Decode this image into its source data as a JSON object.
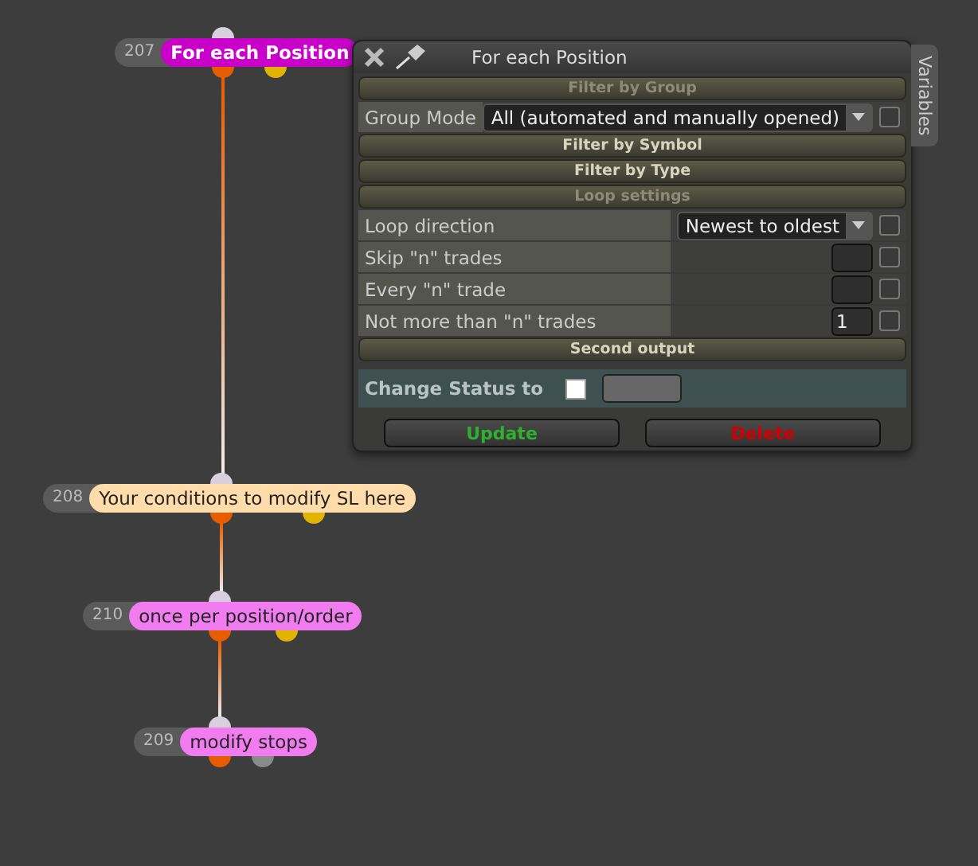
{
  "nodes": [
    {
      "number": "207",
      "label": "For each Position",
      "color": "#c800c8",
      "outputs": [
        {
          "color": "#e85c00"
        },
        {
          "color": "#e0b400"
        }
      ]
    },
    {
      "number": "208",
      "label": "Your conditions to modify SL here",
      "color": "#ffdcaa",
      "outputs": [
        {
          "color": "#e85c00"
        },
        {
          "color": "#e0b400"
        }
      ]
    },
    {
      "number": "210",
      "label": "once per position/order",
      "color": "#f07cf0",
      "outputs": [
        {
          "color": "#e85c00"
        },
        {
          "color": "#e0b400"
        }
      ]
    },
    {
      "number": "209",
      "label": "modify stops",
      "color": "#f07cf0",
      "outputs": [
        {
          "color": "#e85c00"
        },
        {
          "color": "#8a8a8a"
        }
      ]
    }
  ],
  "panel": {
    "title": "For each Position",
    "side_tab": "Variables",
    "sections": [
      {
        "title": "Filter by Group",
        "expanded": true,
        "rows": [
          {
            "kind": "select",
            "label": "Group Mode",
            "value": "All (automated and manually opened)",
            "checked": false
          }
        ]
      },
      {
        "title": "Filter by Symbol",
        "expanded": false
      },
      {
        "title": "Filter by Type",
        "expanded": false
      },
      {
        "title": "Loop settings",
        "expanded": true,
        "rows": [
          {
            "kind": "select",
            "label": "Loop direction",
            "value": "Newest to oldest",
            "checked": false
          },
          {
            "kind": "number",
            "label": "Skip \"n\" trades",
            "checked": false
          },
          {
            "kind": "number",
            "label": "Every \"n\" trade",
            "checked": false
          },
          {
            "kind": "number",
            "label": "Not more than \"n\" trades",
            "value": "1",
            "checked": false
          }
        ]
      },
      {
        "title": "Second output",
        "expanded": false
      }
    ],
    "status": {
      "label": "Change Status to",
      "checked": false
    },
    "buttons": [
      {
        "label": "Update",
        "kind": "update"
      },
      {
        "label": "Delete",
        "kind": "delete"
      }
    ]
  }
}
